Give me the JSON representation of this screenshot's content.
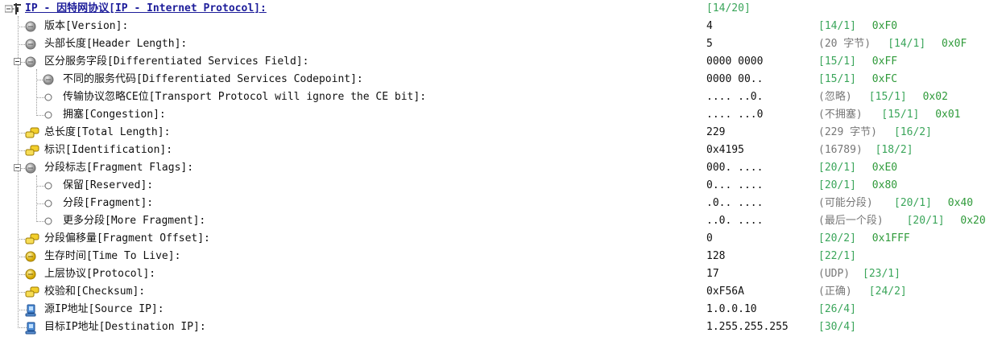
{
  "tree": {
    "header": {
      "label": "IP - 因特网协议[IP - Internet Protocol]:",
      "pos": "[14/20]"
    },
    "rows": [
      {
        "label": "版本[Version]:",
        "value": "4",
        "desc": "",
        "pos": "[14/1]",
        "hex": "0xF0",
        "icon": "gray-ball-icon"
      },
      {
        "label": "头部长度[Header Length]:",
        "value": "5",
        "desc": "(20 字节)",
        "pos": "[14/1]",
        "hex": "0x0F",
        "icon": "gray-ball-icon"
      },
      {
        "label": "区分服务字段[Differentiated Services Field]:",
        "value": "0000 0000",
        "desc": "",
        "pos": "[15/1]",
        "hex": "0xFF",
        "icon": "gray-ball-icon"
      },
      {
        "label": "不同的服务代码[Differentiated Services Codepoint]:",
        "value": "0000 00..",
        "desc": "",
        "pos": "[15/1]",
        "hex": "0xFC",
        "icon": "gray-ball-icon"
      },
      {
        "label": "传输协议忽略CE位[Transport Protocol will ignore the CE bit]:",
        "value": ".... ..0.",
        "desc": "(忽略)",
        "pos": "[15/1]",
        "hex": "0x02",
        "icon": "small-circle-icon"
      },
      {
        "label": "拥塞[Congestion]:",
        "value": ".... ...0",
        "desc": "(不拥塞)",
        "pos": "[15/1]",
        "hex": "0x01",
        "icon": "small-circle-icon"
      },
      {
        "label": "总长度[Total Length]:",
        "value": "229",
        "desc": "(229 字节)",
        "pos": "[16/2]",
        "hex": "",
        "icon": "yellow-pair-icon"
      },
      {
        "label": "标识[Identification]:",
        "value": "0x4195",
        "desc": "(16789)",
        "pos": "[18/2]",
        "hex": "",
        "icon": "yellow-pair-icon"
      },
      {
        "label": "分段标志[Fragment Flags]:",
        "value": "000. ....",
        "desc": "",
        "pos": "[20/1]",
        "hex": "0xE0",
        "icon": "gray-ball-icon"
      },
      {
        "label": "保留[Reserved]:",
        "value": "0... ....",
        "desc": "",
        "pos": "[20/1]",
        "hex": "0x80",
        "icon": "small-circle-icon"
      },
      {
        "label": "分段[Fragment]:",
        "value": ".0.. ....",
        "desc": "(可能分段)",
        "pos": "[20/1]",
        "hex": "0x40",
        "icon": "small-circle-icon"
      },
      {
        "label": "更多分段[More Fragment]:",
        "value": "..0. ....",
        "desc": "(最后一个段)",
        "pos": "[20/1]",
        "hex": "0x20",
        "icon": "small-circle-icon"
      },
      {
        "label": "分段偏移量[Fragment Offset]:",
        "value": "0",
        "desc": "",
        "pos": "[20/2]",
        "hex": "0x1FFF",
        "icon": "yellow-pair-icon"
      },
      {
        "label": "生存时间[Time To Live]:",
        "value": "128",
        "desc": "",
        "pos": "[22/1]",
        "hex": "",
        "icon": "yellow-ball-icon"
      },
      {
        "label": "上层协议[Protocol]:",
        "value": "17",
        "desc": "(UDP)",
        "pos": "[23/1]",
        "hex": "",
        "icon": "yellow-ball-icon"
      },
      {
        "label": "校验和[Checksum]:",
        "value": "0xF56A",
        "desc": "(正确)",
        "pos": "[24/2]",
        "hex": "",
        "icon": "yellow-pair-icon"
      },
      {
        "label": "源IP地址[Source IP]:",
        "value": "1.0.0.10",
        "desc": "",
        "pos": "[26/4]",
        "hex": "",
        "icon": "computer-icon"
      },
      {
        "label": "目标IP地址[Destination IP]:",
        "value": "1.255.255.255",
        "desc": "",
        "pos": "[30/4]",
        "hex": "",
        "icon": "computer-icon"
      }
    ]
  }
}
